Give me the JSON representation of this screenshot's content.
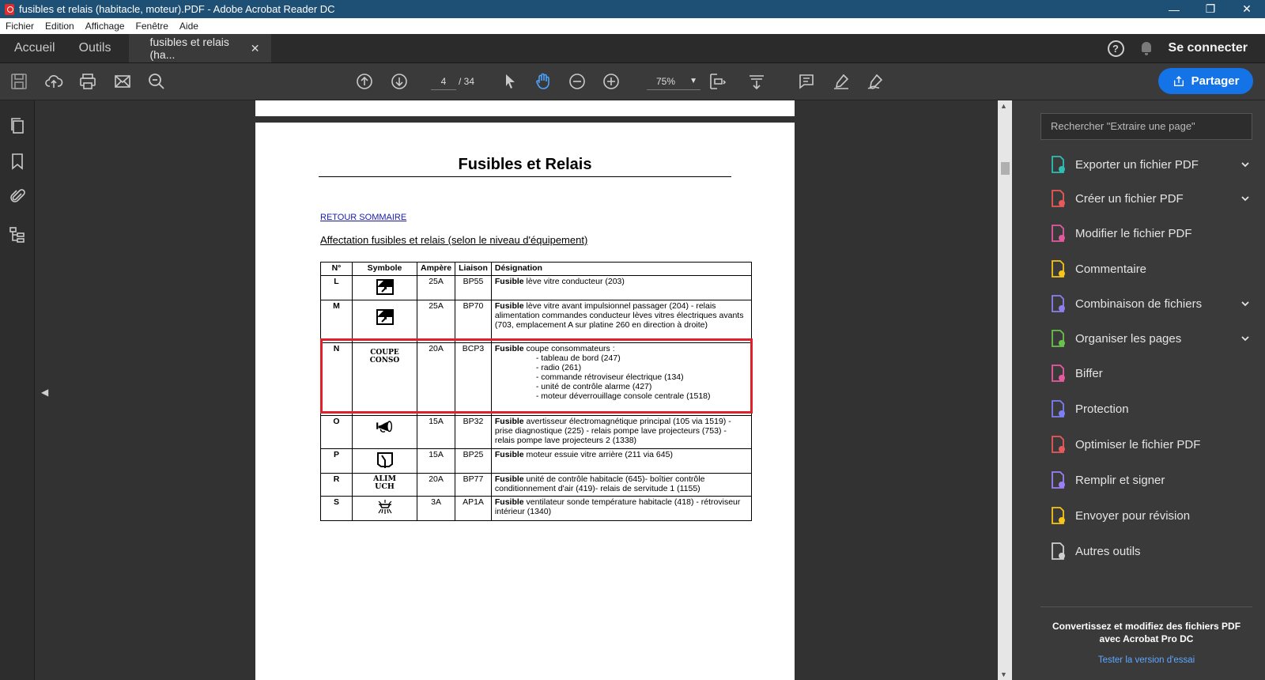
{
  "window": {
    "title": "fusibles et relais (habitacle, moteur).PDF - Adobe Acrobat Reader DC",
    "minimize": "—",
    "maximize": "❐",
    "close": "✕"
  },
  "menu": [
    "Fichier",
    "Edition",
    "Affichage",
    "Fenêtre",
    "Aide"
  ],
  "tabs": {
    "home": "Accueil",
    "tools": "Outils",
    "doc": "fusibles et relais (ha...",
    "doc_close": "✕",
    "signin": "Se connecter",
    "help": "?"
  },
  "toolbar": {
    "page_current": "4",
    "page_total": "/ 34",
    "zoom": "75%",
    "zoom_caret": "▼",
    "share": "Partager"
  },
  "document": {
    "title": "Fusibles et Relais",
    "back_link": "RETOUR SOMMAIRE",
    "subtitle": "Affectation fusibles et relais (selon le niveau d'équipement)",
    "headers": [
      "N°",
      "Symbole",
      "Ampère",
      "Liaison",
      "Désignation"
    ],
    "rows": [
      {
        "n": "L",
        "amp": "25A",
        "liaison": "BP55",
        "bold": "Fusible",
        "text": " lève vitre conducteur (203)"
      },
      {
        "n": "M",
        "amp": "25A",
        "liaison": "BP70",
        "bold": "Fusible",
        "text": " lève vitre avant impulsionnel passager (204) - relais alimentation commandes conducteur lèves vitres électriques avants (703, emplacement A sur platine 260 en direction à droite)"
      },
      {
        "n": "N",
        "symbol_text": [
          "COUPE",
          "CONSO"
        ],
        "amp": "20A",
        "liaison": "BCP3",
        "bold": "Fusible",
        "text": " coupe consommateurs :",
        "items": [
          "- tableau de bord (247)",
          "- radio (261)",
          "- commande rétroviseur électrique (134)",
          "- unité de contrôle alarme (427)",
          "- moteur déverrouillage console centrale (1518)"
        ]
      },
      {
        "n": "O",
        "amp": "15A",
        "liaison": "BP32",
        "bold": "Fusible",
        "text": " avertisseur électromagnétique principal (105 via 1519) - prise diagnostique (225) - relais pompe lave projecteurs (753) - relais pompe lave projecteurs 2 (1338)"
      },
      {
        "n": "P",
        "amp": "15A",
        "liaison": "BP25",
        "bold": "Fusible",
        "text": " moteur essuie vitre arrière (211 via 645)"
      },
      {
        "n": "R",
        "symbol_text": [
          "ALIM",
          "UCH"
        ],
        "amp": "20A",
        "liaison": "BP77",
        "bold": "Fusible",
        "text": " unité de contrôle habitacle (645)- boîtier contrôle conditionnement d'air (419)- relais de servitude 1 (1155)"
      },
      {
        "n": "S",
        "amp": "3A",
        "liaison": "AP1A",
        "bold": "Fusible",
        "text": " ventilateur sonde température habitacle (418) - rétroviseur intérieur (1340)"
      }
    ]
  },
  "right_panel": {
    "search_placeholder": "Rechercher \"Extraire une page\"",
    "tools": [
      {
        "label": "Exporter un fichier PDF",
        "color": "#2dbfb4",
        "chevron": true
      },
      {
        "label": "Créer un fichier PDF",
        "color": "#e85a5a",
        "chevron": true
      },
      {
        "label": "Modifier le fichier PDF",
        "color": "#e05aa0",
        "chevron": false
      },
      {
        "label": "Commentaire",
        "color": "#f5c518",
        "chevron": false
      },
      {
        "label": "Combinaison de fichiers",
        "color": "#8c7ff0",
        "chevron": true
      },
      {
        "label": "Organiser les pages",
        "color": "#6bc24a",
        "chevron": true
      },
      {
        "label": "Biffer",
        "color": "#e85aa0",
        "chevron": false
      },
      {
        "label": "Protection",
        "color": "#7c7ff5",
        "chevron": false
      },
      {
        "label": "Optimiser le fichier PDF",
        "color": "#e85a5a",
        "chevron": false
      },
      {
        "label": "Remplir et signer",
        "color": "#9b7ff5",
        "chevron": false
      },
      {
        "label": "Envoyer pour révision",
        "color": "#f5c518",
        "chevron": false
      },
      {
        "label": "Autres outils",
        "color": "#cfcfcf",
        "chevron": false
      }
    ],
    "promo": "Convertissez et modifiez des fichiers PDF avec Acrobat Pro DC",
    "promo_link": "Tester la version d'essai"
  },
  "colors": {
    "accent": "#1473e6",
    "highlight": "#e0202a",
    "titlebar": "#1e4f75"
  }
}
